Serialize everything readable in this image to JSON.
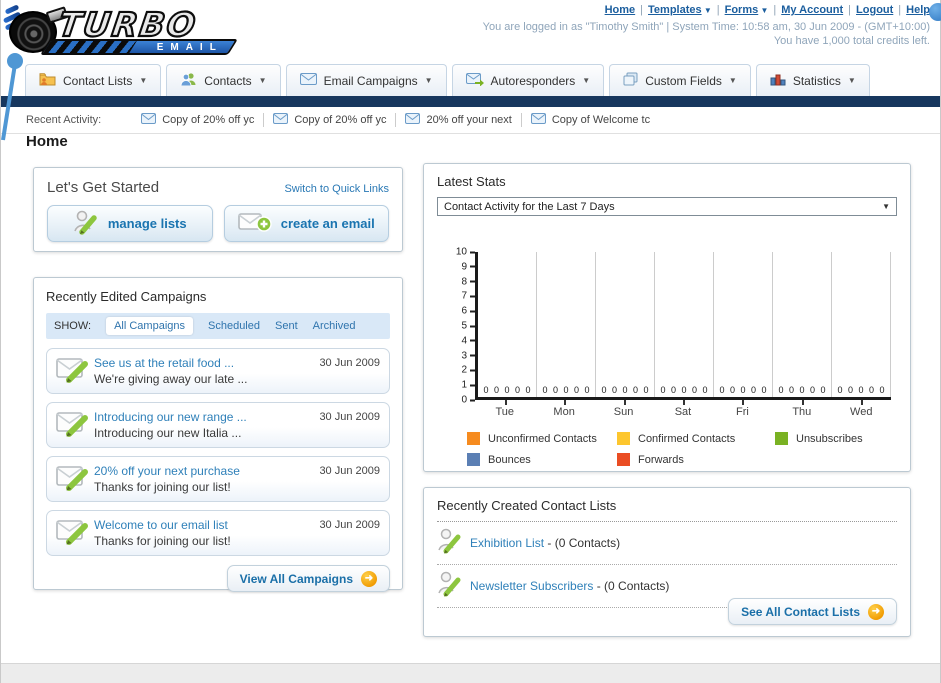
{
  "header": {
    "logo_title": "TURBO",
    "logo_subtitle": "EMAIL",
    "nav_links": [
      {
        "label": "Home",
        "dropdown": false
      },
      {
        "label": "Templates",
        "dropdown": true
      },
      {
        "label": "Forms",
        "dropdown": true
      },
      {
        "label": "My Account",
        "dropdown": false
      },
      {
        "label": "Logout",
        "dropdown": false
      },
      {
        "label": "Help",
        "dropdown": false
      }
    ],
    "status_line1": "You are logged in as \"Timothy Smith\" | System Time: 10:58 am, 30 Jun 2009 - (GMT+10:00)",
    "status_line2": "You have 1,000 total credits left."
  },
  "nav_tabs": [
    {
      "label": "Contact Lists",
      "icon": "contact-lists-icon"
    },
    {
      "label": "Contacts",
      "icon": "contacts-icon"
    },
    {
      "label": "Email Campaigns",
      "icon": "envelope-icon"
    },
    {
      "label": "Autoresponders",
      "icon": "envelope-arrow-icon"
    },
    {
      "label": "Custom Fields",
      "icon": "pages-icon"
    },
    {
      "label": "Statistics",
      "icon": "bar-chart-icon"
    }
  ],
  "recent_activity": {
    "label": "Recent Activity:",
    "items": [
      "Copy of 20% off yc",
      "Copy of 20% off yc",
      "20% off your next",
      "Copy of Welcome tc"
    ]
  },
  "page_title": "Home",
  "get_started": {
    "title": "Let's Get Started",
    "switch_link": "Switch to Quick Links",
    "buttons": [
      {
        "label": "manage lists",
        "icon": "person-pencil-icon"
      },
      {
        "label": "create an email",
        "icon": "envelope-plus-icon"
      }
    ]
  },
  "campaigns": {
    "title": "Recently Edited Campaigns",
    "show_label": "SHOW:",
    "filters": [
      {
        "label": "All Campaigns",
        "active": true
      },
      {
        "label": "Scheduled",
        "active": false
      },
      {
        "label": "Sent",
        "active": false
      },
      {
        "label": "Archived",
        "active": false
      }
    ],
    "rows": [
      {
        "title": "See us at the retail food ...",
        "subtitle": "We're giving away our late ...",
        "date": "30 Jun 2009"
      },
      {
        "title": "Introducing our new range ...",
        "subtitle": "Introducing our new Italia ...",
        "date": "30 Jun 2009"
      },
      {
        "title": "20% off your next purchase",
        "subtitle": "Thanks for joining our list!",
        "date": "30 Jun 2009"
      },
      {
        "title": "Welcome to our email list",
        "subtitle": "Thanks for joining our list!",
        "date": "30 Jun 2009"
      }
    ],
    "view_all_label": "View All Campaigns"
  },
  "latest_stats": {
    "title": "Latest Stats",
    "dropdown_value": "Contact Activity for the Last 7 Days"
  },
  "chart_data": {
    "type": "bar",
    "categories": [
      "Tue",
      "Mon",
      "Sun",
      "Sat",
      "Fri",
      "Thu",
      "Wed"
    ],
    "series": [
      {
        "name": "Unconfirmed Contacts",
        "color": "#f68b1f",
        "values": [
          0,
          0,
          0,
          0,
          0,
          0,
          0
        ]
      },
      {
        "name": "Confirmed Contacts",
        "color": "#fdc62e",
        "values": [
          0,
          0,
          0,
          0,
          0,
          0,
          0
        ]
      },
      {
        "name": "Unsubscribes",
        "color": "#7ab223",
        "values": [
          0,
          0,
          0,
          0,
          0,
          0,
          0
        ]
      },
      {
        "name": "Bounces",
        "color": "#5b7fb4",
        "values": [
          0,
          0,
          0,
          0,
          0,
          0,
          0
        ]
      },
      {
        "name": "Forwards",
        "color": "#ea4d23",
        "values": [
          0,
          0,
          0,
          0,
          0,
          0,
          0
        ]
      }
    ],
    "title": "Contact Activity for the Last 7 Days",
    "xlabel": "",
    "ylabel": "",
    "ylim": [
      0,
      10
    ],
    "yticks": [
      0,
      1,
      2,
      3,
      4,
      5,
      6,
      7,
      8,
      9,
      10
    ],
    "grid": true,
    "legend_position": "bottom",
    "value_label_per_bar": "0"
  },
  "contact_lists": {
    "title": "Recently Created Contact Lists",
    "items": [
      {
        "name": "Exhibition List",
        "suffix": "- (0 Contacts)"
      },
      {
        "name": "Newsletter Subscribers",
        "suffix": "- (0 Contacts)"
      }
    ],
    "see_all_label": "See All Contact Lists"
  }
}
